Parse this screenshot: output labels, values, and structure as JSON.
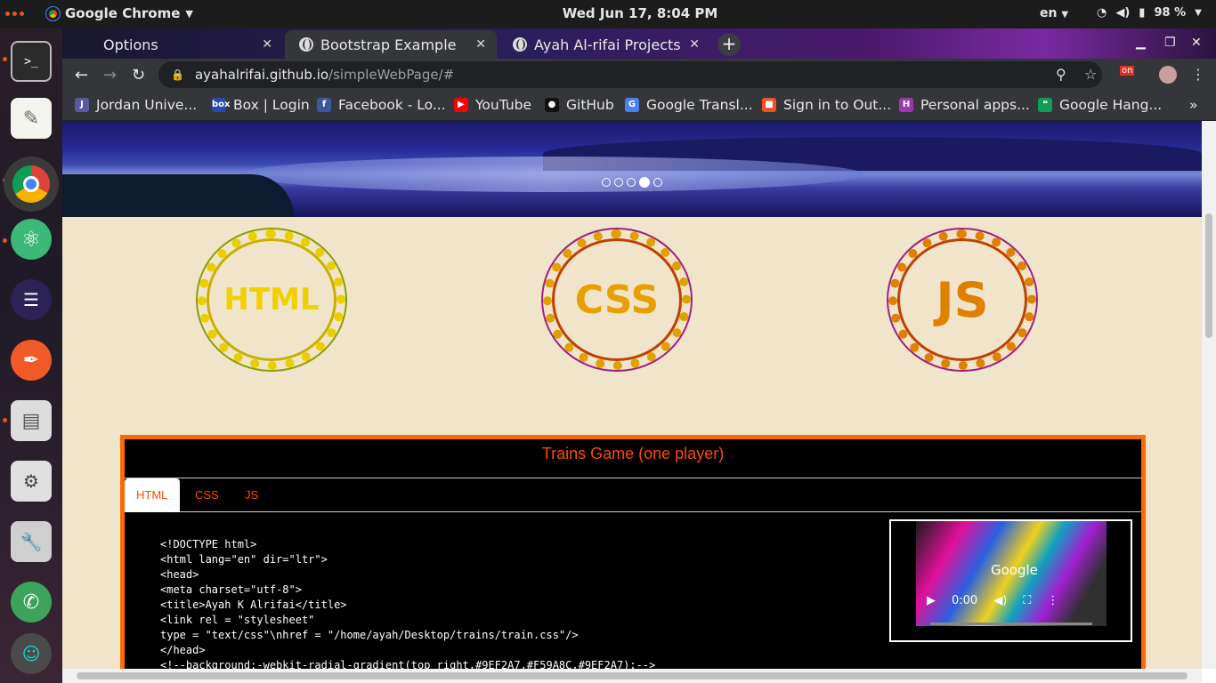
{
  "topbar": {
    "app_name": "Google Chrome",
    "clock": "Wed Jun 17,  8:04 PM",
    "lang": "en",
    "battery": "98 %"
  },
  "dock": {
    "items": [
      "terminal",
      "text-editor",
      "chrome",
      "atom",
      "eclipse",
      "inkscape",
      "files",
      "mixer",
      "settings",
      "phone",
      "avatar"
    ]
  },
  "tabs": [
    {
      "label": "Options"
    },
    {
      "label": "Bootstrap Example"
    },
    {
      "label": "Ayah Al-rifai Projects"
    }
  ],
  "omnibox": {
    "host": "ayahalrifai.github.io",
    "path": "/simpleWebPage/#"
  },
  "bookmarks": [
    {
      "label": "Jordan Unive...",
      "color": "#5a5aa0",
      "icon": "J"
    },
    {
      "label": "Box | Login",
      "color": "#2a4aaa",
      "icon": "box"
    },
    {
      "label": "Facebook - Lo...",
      "color": "#3b5998",
      "icon": "f"
    },
    {
      "label": "YouTube",
      "color": "#ff0000",
      "icon": "▶"
    },
    {
      "label": "GitHub",
      "color": "#111111",
      "icon": "●"
    },
    {
      "label": "Google Transl...",
      "color": "#4a80f0",
      "icon": "G"
    },
    {
      "label": "Sign in to Out...",
      "color": "#f25022",
      "icon": "■"
    },
    {
      "label": "Personal apps...",
      "color": "#9a3ab0",
      "icon": "H"
    },
    {
      "label": "Google Hang...",
      "color": "#0f9d58",
      "icon": "❝"
    }
  ],
  "page": {
    "carousel_active": 4,
    "carousel_count": 5,
    "wreaths": [
      {
        "label": "HTML",
        "text_color": "#f0d000"
      },
      {
        "label": "CSS",
        "text_color": "#e8a000"
      },
      {
        "label": "JS",
        "text_color": "#e08000"
      }
    ],
    "project": {
      "title": "Trains Game (one player)",
      "tabs": [
        "HTML",
        "CSS",
        "JS"
      ],
      "active_tab": "HTML",
      "code_lines": [
        "<!DOCTYPE html>",
        "<html lang=\"en\" dir=\"ltr\">",
        "<head>",
        "<meta charset=\"utf-8\">",
        "<title>Ayah K Alrifai</title>",
        "<link rel = \"stylesheet\"",
        "type = \"text/css\"\\nhref = \"/home/ayah/Desktop/trains/train.css\"/>",
        "</head>",
        "<!--background:-webkit-radial-gradient(top right,#9EF2A7,#F59A8C,#9EF2A7);-->"
      ],
      "video_time": "0:00",
      "video_overlay_text": "Google"
    }
  }
}
